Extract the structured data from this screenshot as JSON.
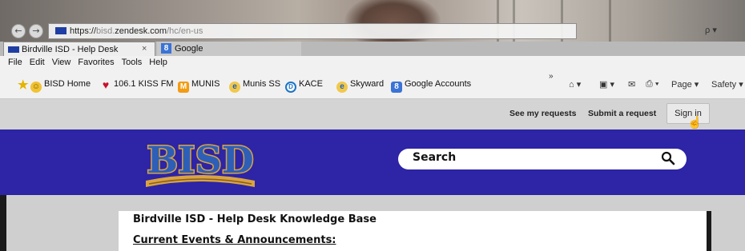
{
  "browser": {
    "address": {
      "scheme": "https://",
      "host_grey": "bisd.",
      "host": "zendesk.com",
      "path": "/hc/en-us"
    },
    "address_right": "ρ ▾",
    "tabs": [
      {
        "label": "Birdville ISD - Help Desk",
        "close": "×",
        "active": true
      },
      {
        "label": "Google",
        "active": false
      }
    ],
    "menu": [
      "File",
      "Edit",
      "View",
      "Favorites",
      "Tools",
      "Help"
    ],
    "favorites": [
      {
        "label": "BISD Home",
        "icon": "smiley-icon"
      },
      {
        "label": "106.1 KISS FM",
        "icon": "heart-radio-icon"
      },
      {
        "label": "MUNIS",
        "icon": "munis-icon"
      },
      {
        "label": "Munis SS",
        "icon": "ie-icon"
      },
      {
        "label": "KACE",
        "icon": "dell-icon"
      },
      {
        "label": "Skyward",
        "icon": "ie-icon"
      },
      {
        "label": "Google Accounts",
        "icon": "google-icon"
      }
    ],
    "overflow": "»",
    "commands": [
      "Page ▾",
      "Safety ▾"
    ]
  },
  "site": {
    "top_links": {
      "requests": "See my requests",
      "submit": "Submit a request",
      "signin": "Sign in"
    },
    "logo_text": "BISD",
    "search_placeholder": "Search",
    "kb_title": "Birdville ISD - Help Desk Knowledge Base",
    "kb_section": "Current Events & Announcements:"
  },
  "colors": {
    "banner": "#2d24a6",
    "logo_gold": "#d9a441",
    "logo_blue": "#2e5fb8"
  }
}
